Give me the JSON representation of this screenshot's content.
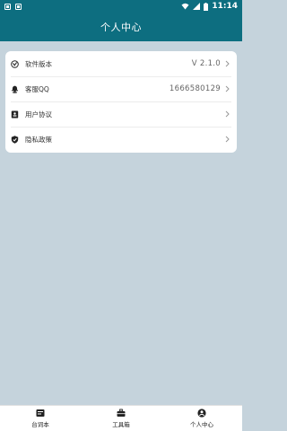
{
  "status_bar": {
    "time": "11:14"
  },
  "header": {
    "title": "个人中心"
  },
  "settings": {
    "items": [
      {
        "label": "软件版本",
        "value": "V 2.1.0",
        "icon": "version-icon"
      },
      {
        "label": "客服QQ",
        "value": "1666580129",
        "icon": "qq-icon"
      },
      {
        "label": "用户协议",
        "value": "",
        "icon": "agreement-icon"
      },
      {
        "label": "隐私政策",
        "value": "",
        "icon": "shield-icon"
      }
    ]
  },
  "tabbar": {
    "tabs": [
      {
        "label": "台词本",
        "icon": "script-book-icon"
      },
      {
        "label": "工具箱",
        "icon": "toolbox-icon"
      },
      {
        "label": "个人中心",
        "icon": "profile-icon"
      }
    ]
  }
}
